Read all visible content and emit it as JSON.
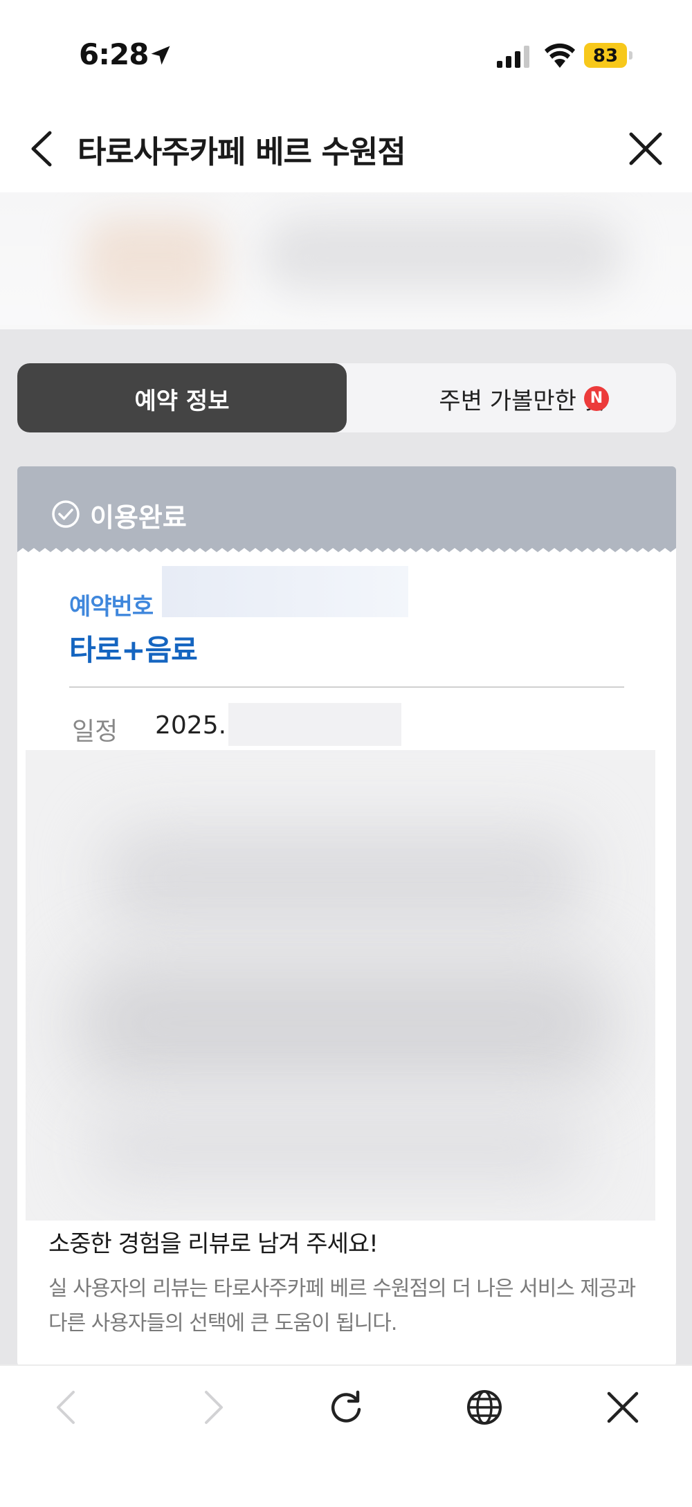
{
  "status_bar": {
    "time": "6:28",
    "battery": "83"
  },
  "header": {
    "title": "타로사주카페 베르 수원점"
  },
  "tabs": [
    {
      "label": "예약 정보",
      "active": true
    },
    {
      "label": "주변 가볼만한 곳",
      "badge": "N"
    }
  ],
  "status": {
    "text": "이용완료"
  },
  "booking": {
    "number_label": "예약번호",
    "product": "타로+음료",
    "schedule_label": "일정",
    "schedule_value": "2025."
  },
  "review": {
    "title": "소중한 경험을 리뷰로 남겨 주세요!",
    "description": "실 사용자의 리뷰는 타로사주카페 베르 수원점의 더 나은 서비스 제공과 다른 사용자들의 선택에 큰 도움이 됩니다."
  },
  "colors": {
    "active_tab": "#444444",
    "status_bar_bg": "#b0b6c0",
    "reservation_label": "#3f87dc",
    "product": "#1565c0",
    "badge": "#ec3b3b",
    "battery": "#f7c81b"
  },
  "icons": {
    "status": [
      "location-arrow-icon",
      "cellular-signal-icon",
      "wifi-icon",
      "battery-icon"
    ],
    "header": [
      "chevron-left-icon",
      "close-icon"
    ],
    "toolbar": [
      "back-icon",
      "forward-icon",
      "refresh-icon",
      "globe-icon",
      "close-icon"
    ]
  }
}
